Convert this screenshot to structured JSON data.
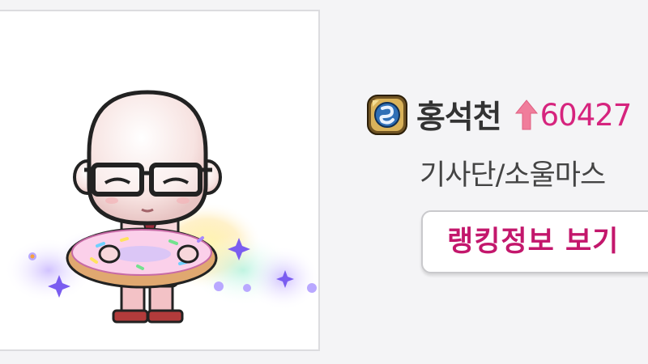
{
  "character": {
    "name": "홍석천",
    "rank_change": "60427",
    "job": "기사단/소울마스",
    "world_icon": "world-emblem-icon"
  },
  "actions": {
    "ranking_button_label": "랭킹정보 보기"
  },
  "colors": {
    "page_bg": "#f4f4f6",
    "name": "#333333",
    "rank_up": "#d6247e",
    "button_text": "#c3176c",
    "arrow": "#f07d9b"
  }
}
